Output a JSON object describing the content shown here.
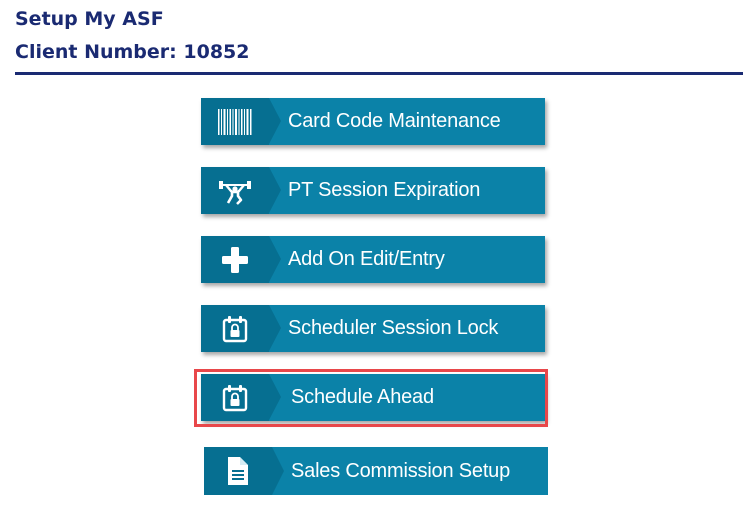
{
  "header": {
    "title": "Setup My ASF",
    "client_number": "Client Number: 10852"
  },
  "menu": {
    "items": [
      {
        "label": "Card Code Maintenance",
        "icon": "barcode-icon"
      },
      {
        "label": "PT Session Expiration",
        "icon": "weightlifter-icon"
      },
      {
        "label": "Add On Edit/Entry",
        "icon": "plus-icon"
      },
      {
        "label": "Scheduler Session Lock",
        "icon": "calendar-lock-icon"
      },
      {
        "label": "Schedule Ahead",
        "icon": "calendar-lock-icon",
        "highlighted": true
      },
      {
        "label": "Sales Commission Setup",
        "icon": "document-icon"
      }
    ]
  },
  "colors": {
    "heading": "#1a2a72",
    "button": "#0b82a8",
    "button_icon_panel": "#066f91",
    "highlight_border": "#e8474a"
  }
}
